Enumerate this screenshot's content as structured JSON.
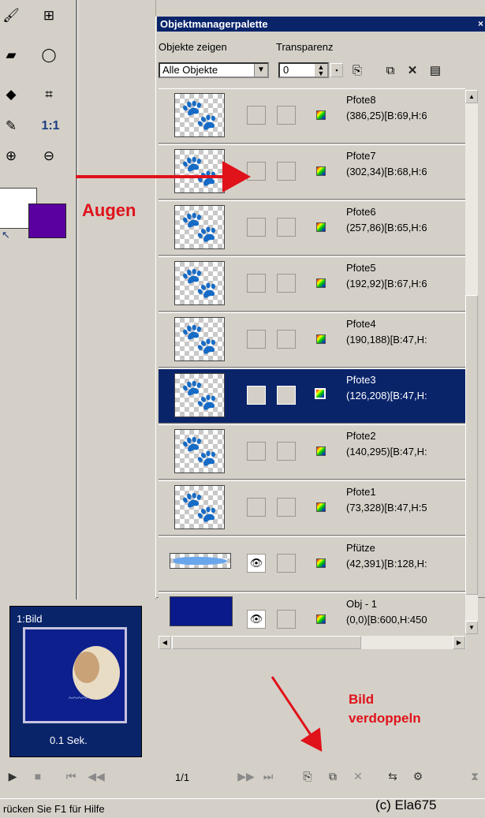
{
  "toolbox": {
    "tools": [
      {
        "name": "brush-tool-icon",
        "glyph": "🖌"
      },
      {
        "name": "lasso-tool-icon",
        "glyph": "⊞"
      },
      {
        "name": "eraser-tool-icon",
        "glyph": "▰"
      },
      {
        "name": "selection-tool-icon",
        "glyph": "◯"
      },
      {
        "name": "fill-tool-icon",
        "glyph": "◆"
      },
      {
        "name": "crop-tool-icon",
        "glyph": "⌗"
      },
      {
        "name": "eyedropper-tool-icon",
        "glyph": "✎"
      },
      {
        "name": "zoom-1to1-icon",
        "text": "1:1"
      },
      {
        "name": "zoom-in-icon",
        "glyph": "⊕"
      },
      {
        "name": "zoom-out-icon",
        "glyph": "⊖"
      }
    ],
    "foreground_color": "#5b00a0",
    "background_color": "#ffffff"
  },
  "annotation_eyes": "Augen",
  "palette": {
    "title": "Objektmanagerpalette",
    "show_label": "Objekte zeigen",
    "transparency_label": "Transparenz",
    "show_value": "Alle Objekte",
    "transparency_value": "0",
    "toolbar_icons": [
      "new-object-icon",
      "copy-object-icon",
      "delete-icon",
      "properties-icon"
    ],
    "rows": [
      {
        "name": "Pfote8",
        "info": "(386,25)[B:69,H:6",
        "visible": false,
        "selected": false,
        "thumb": "paw"
      },
      {
        "name": "Pfote7",
        "info": "(302,34)[B:68,H:6",
        "visible": false,
        "selected": false,
        "thumb": "paw"
      },
      {
        "name": "Pfote6",
        "info": "(257,86)[B:65,H:6",
        "visible": false,
        "selected": false,
        "thumb": "paw"
      },
      {
        "name": "Pfote5",
        "info": "(192,92)[B:67,H:6",
        "visible": false,
        "selected": false,
        "thumb": "paw"
      },
      {
        "name": "Pfote4",
        "info": "(190,188)[B:47,H:",
        "visible": false,
        "selected": false,
        "thumb": "paw"
      },
      {
        "name": "Pfote3",
        "info": "(126,208)[B:47,H:",
        "visible": false,
        "selected": true,
        "thumb": "paw"
      },
      {
        "name": "Pfote2",
        "info": "(140,295)[B:47,H:",
        "visible": false,
        "selected": false,
        "thumb": "paw"
      },
      {
        "name": "Pfote1",
        "info": "(73,328)[B:47,H:5",
        "visible": false,
        "selected": false,
        "thumb": "paw"
      },
      {
        "name": "Pfütze",
        "info": "(42,391)[B:128,H:",
        "visible": true,
        "selected": false,
        "thumb": "puddle"
      },
      {
        "name": "Obj - 1",
        "info": "(0,0)[B:600,H:450",
        "visible": true,
        "selected": false,
        "thumb": "dark"
      }
    ]
  },
  "frame": {
    "label": "1:Bild",
    "time": "0.1 Sek."
  },
  "annotation_duplicate": "Bild\nverdoppeln",
  "annotation_duplicate_lines": [
    "Bild",
    "verdoppeln"
  ],
  "player": {
    "frame_count": "1/1"
  },
  "status": {
    "text": "rücken Sie F1 für Hilfe",
    "credit": "(c) Ela675"
  }
}
